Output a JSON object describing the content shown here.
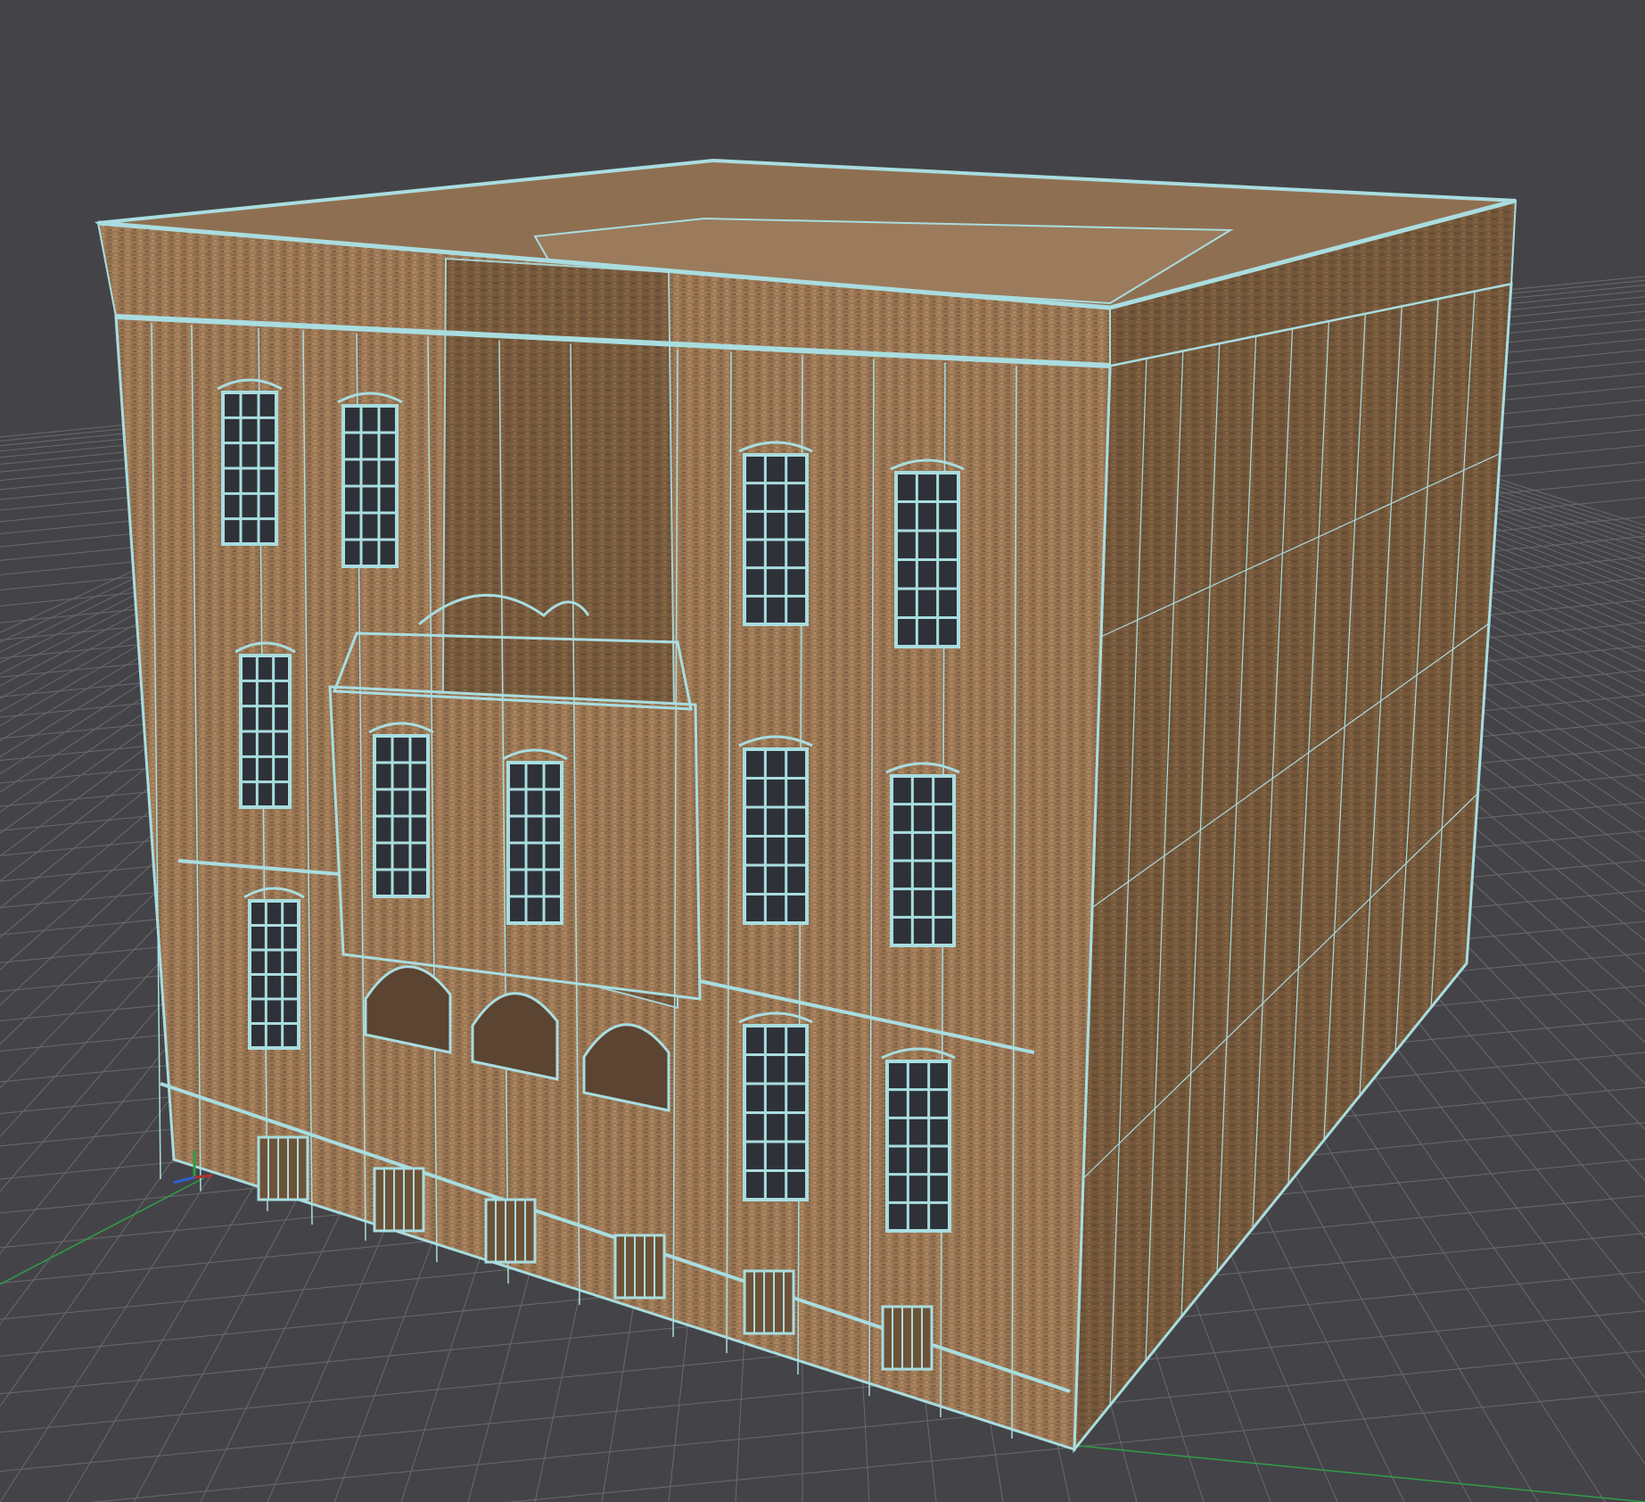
{
  "viewport": {
    "background_color": "#444448",
    "grid_color": "#6a6a6e",
    "grid_major_color": "#7a7a7e",
    "axis_x_color": "#b03030",
    "axis_y_color": "#2f9e44",
    "axis_z_color": "#2f5fd0",
    "axis_gizmo_icon": "xyz-axis-gizmo-icon"
  },
  "model": {
    "name": "brick-building-wireframe",
    "texture_color": "#9a7654",
    "texture_dark_color": "#7b5c40",
    "texture_light_color": "#b08a63",
    "wireframe_color": "#a9dde0",
    "window_glass_color": "#2e3238",
    "shaded_side_color": "#6f5439"
  }
}
